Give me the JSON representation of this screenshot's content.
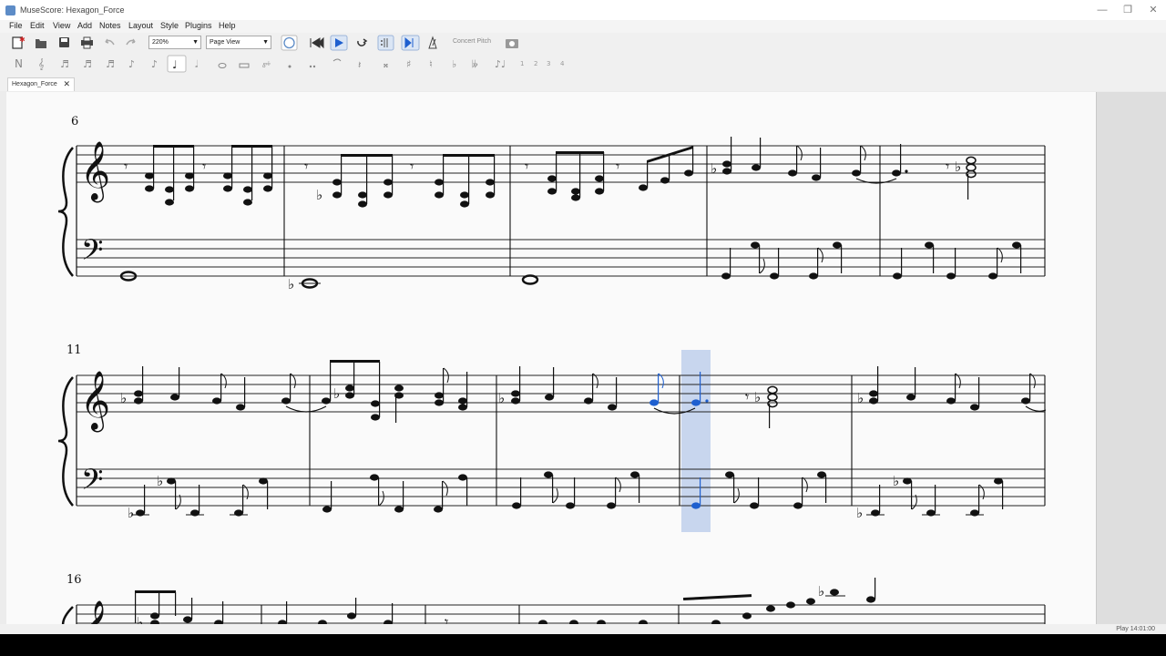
{
  "window": {
    "title": "MuseScore: Hexagon_Force",
    "minimize_glyph": "—",
    "restore_glyph": "❐",
    "close_glyph": "✕"
  },
  "menu": {
    "items": [
      {
        "label": "File"
      },
      {
        "label": "Edit"
      },
      {
        "label": "View"
      },
      {
        "label": "Add"
      },
      {
        "label": "Notes"
      },
      {
        "label": "Layout"
      },
      {
        "label": "Style"
      },
      {
        "label": "Plugins"
      },
      {
        "label": "Help"
      }
    ]
  },
  "toolbar": {
    "zoom": "220%",
    "view_mode": "Page View",
    "concert_pitch": "Concert Pitch"
  },
  "note_input": {
    "voices": [
      "1",
      "2",
      "3",
      "4"
    ]
  },
  "tabs": [
    {
      "label": "Hexagon_Force"
    }
  ],
  "score": {
    "systems": [
      {
        "measure_number": "6"
      },
      {
        "measure_number": "11"
      },
      {
        "measure_number": "16"
      }
    ],
    "selection_color": "#c8d6ee",
    "selected_note_color": "#1e5fcf"
  },
  "statusbar": {
    "text": "Play  14:01:00"
  },
  "icons": {
    "accidental_flat": "♭",
    "accidental_sharp": "♯",
    "accidental_natural": "♮",
    "double_flat": "𝄫",
    "double_sharp": "𝄪"
  }
}
